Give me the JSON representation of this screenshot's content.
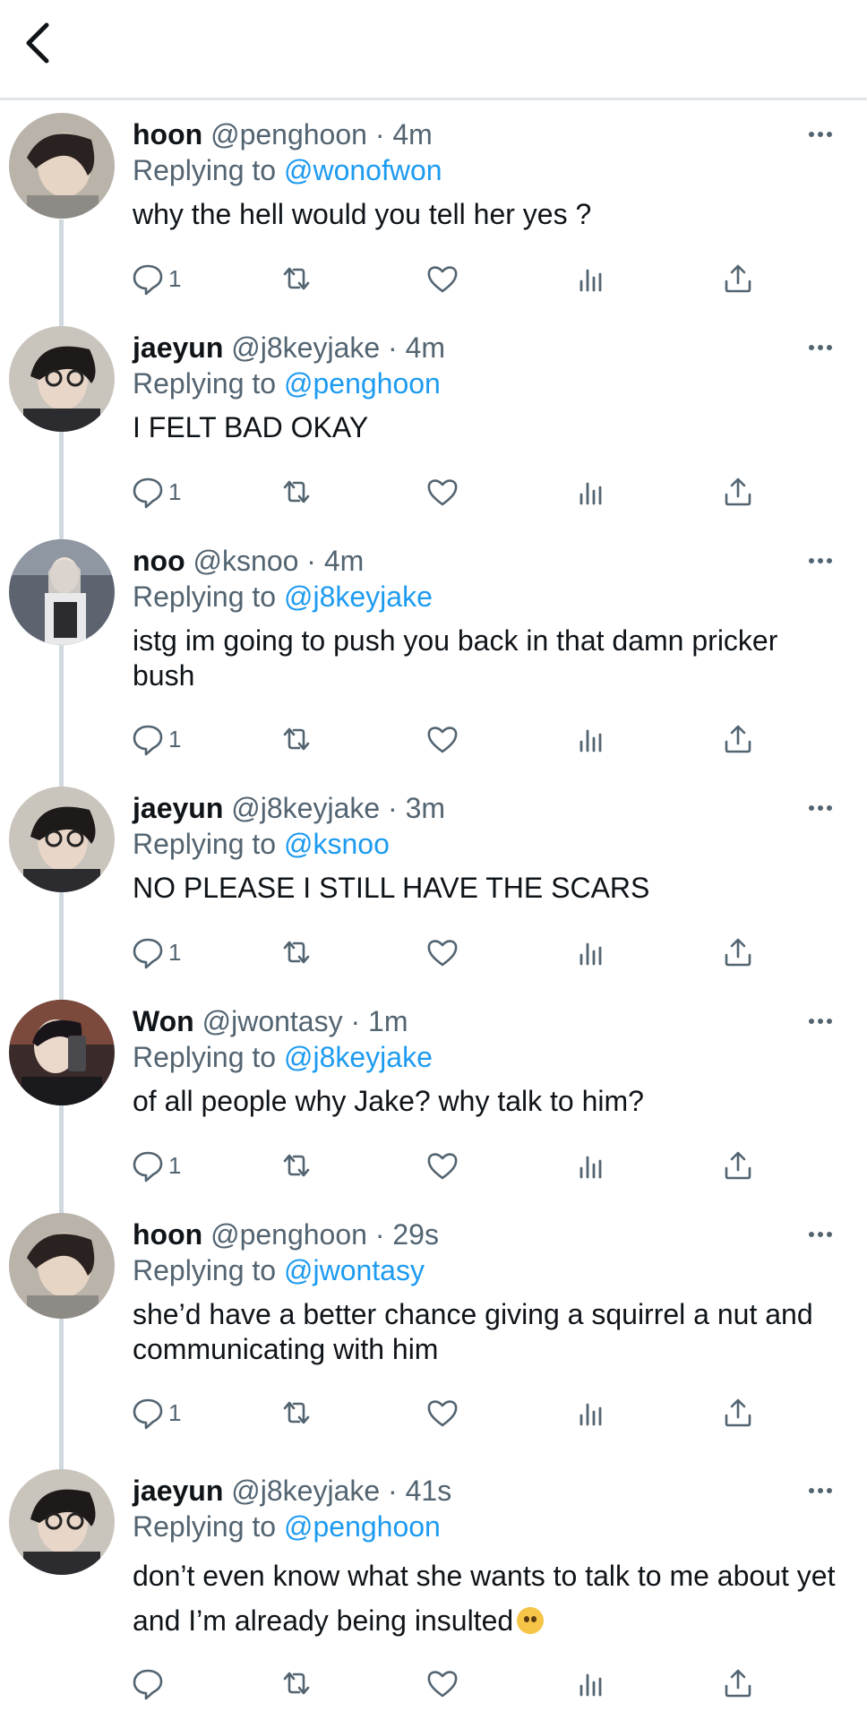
{
  "header": {
    "back_icon": "chevron-left-icon"
  },
  "colors": {
    "link": "#1d9bf0",
    "muted": "#536471",
    "text": "#0f1419",
    "divider": "#e1e5e8"
  },
  "tweets": [
    {
      "name": "hoon",
      "handle": "@penghoon",
      "dot": "·",
      "time": "4m",
      "replying_prefix": "Replying to ",
      "replying_to": "@wonofwon",
      "text": "why the hell would you tell her yes ?",
      "reply_count": "1"
    },
    {
      "name": "jaeyun",
      "handle": "@j8keyjake",
      "dot": "·",
      "time": "4m",
      "replying_prefix": "Replying to ",
      "replying_to": "@penghoon",
      "text": "I FELT BAD OKAY",
      "reply_count": "1"
    },
    {
      "name": "noo",
      "handle": "@ksnoo",
      "dot": "·",
      "time": "4m",
      "replying_prefix": "Replying to ",
      "replying_to": "@j8keyjake",
      "text": "istg im going to push you back in that damn pricker bush",
      "reply_count": "1"
    },
    {
      "name": "jaeyun",
      "handle": "@j8keyjake",
      "dot": "·",
      "time": "3m",
      "replying_prefix": "Replying to ",
      "replying_to": "@ksnoo",
      "text": "NO PLEASE I STILL HAVE THE SCARS",
      "reply_count": "1"
    },
    {
      "name": "Won",
      "handle": "@jwontasy",
      "dot": "·",
      "time": "1m",
      "replying_prefix": "Replying to ",
      "replying_to": "@j8keyjake",
      "text": "of all people why Jake? why talk to him?",
      "reply_count": "1"
    },
    {
      "name": "hoon",
      "handle": "@penghoon",
      "dot": "·",
      "time": "29s",
      "replying_prefix": "Replying to ",
      "replying_to": "@jwontasy",
      "text": "she’d have a better chance giving a squirrel a nut and communicating with him",
      "reply_count": "1"
    },
    {
      "name": "jaeyun",
      "handle": "@j8keyjake",
      "dot": "·",
      "time": "41s",
      "replying_prefix": "Replying to ",
      "replying_to": "@penghoon",
      "text": "don’t even know what she wants to talk to me about yet and I’m already being insulted",
      "reply_count": ""
    }
  ],
  "action_icons": [
    "reply-icon",
    "retweet-icon",
    "like-icon",
    "views-icon",
    "share-icon"
  ],
  "avatar_icons": [
    "avatar-hoon",
    "avatar-jaeyun",
    "avatar-noo",
    "avatar-jaeyun",
    "avatar-won",
    "avatar-hoon",
    "avatar-jaeyun"
  ]
}
